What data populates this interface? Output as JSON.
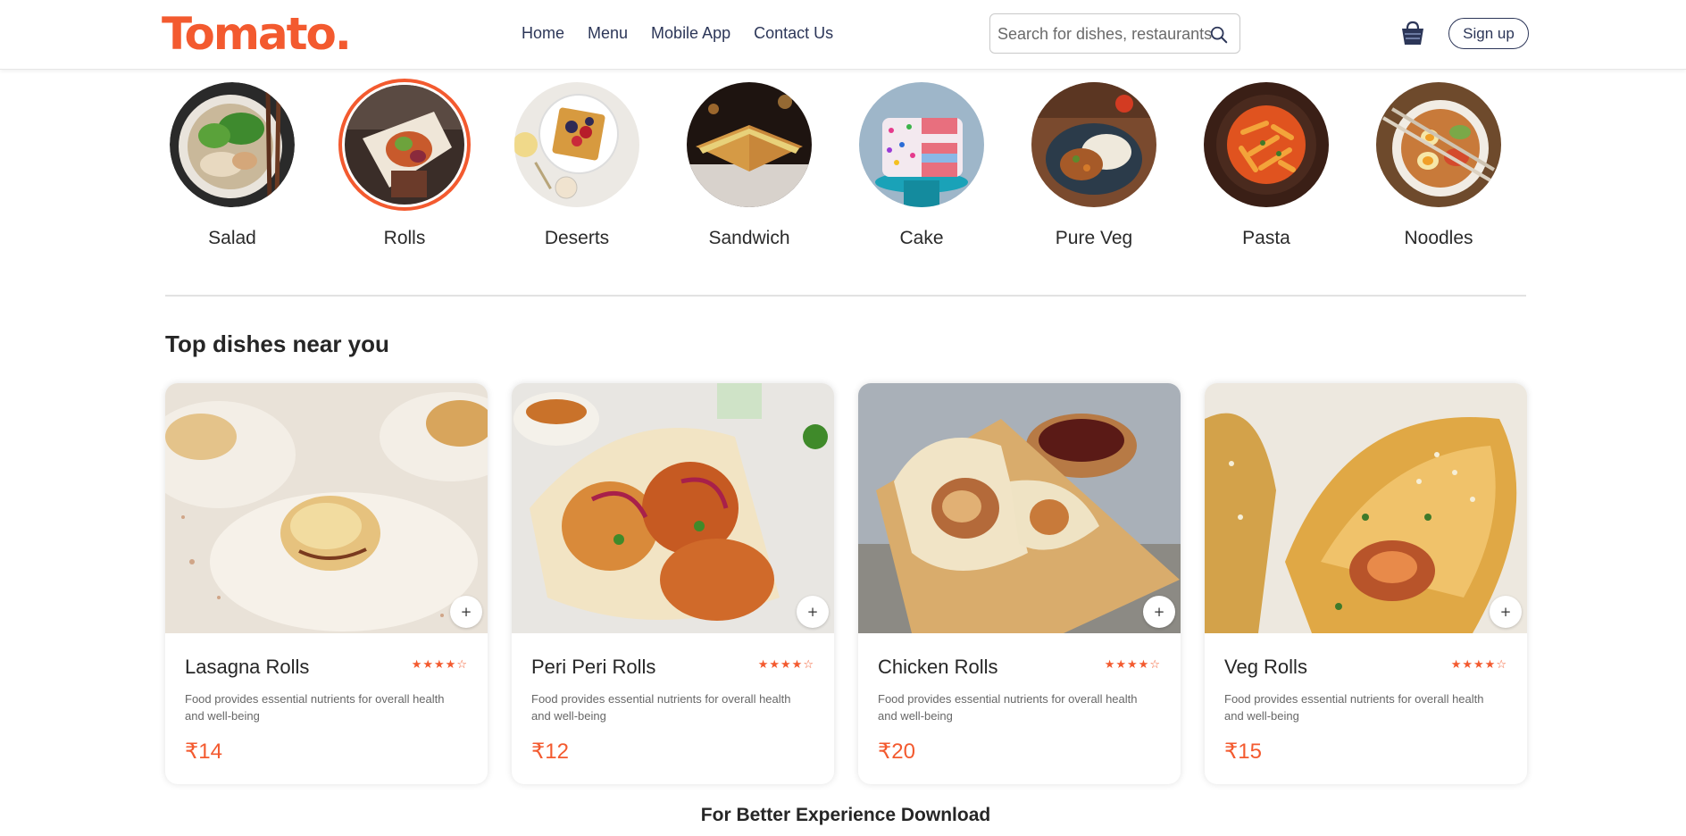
{
  "header": {
    "logo": "Tomato.",
    "nav": [
      "Home",
      "Menu",
      "Mobile App",
      "Contact Us"
    ],
    "search_placeholder": "Search for dishes, restaurants...",
    "signup_label": "Sign up",
    "accent_color": "#f35a2f"
  },
  "categories": [
    {
      "label": "Salad",
      "icon": "salad-image",
      "active": false
    },
    {
      "label": "Rolls",
      "icon": "rolls-image",
      "active": true
    },
    {
      "label": "Deserts",
      "icon": "deserts-image",
      "active": false
    },
    {
      "label": "Sandwich",
      "icon": "sandwich-image",
      "active": false
    },
    {
      "label": "Cake",
      "icon": "cake-image",
      "active": false
    },
    {
      "label": "Pure Veg",
      "icon": "pure-veg-image",
      "active": false
    },
    {
      "label": "Pasta",
      "icon": "pasta-image",
      "active": false
    },
    {
      "label": "Noodles",
      "icon": "noodles-image",
      "active": false
    }
  ],
  "dishes_section": {
    "title": "Top dishes near you",
    "items": [
      {
        "name": "Lasagna Rolls",
        "rating": 4,
        "description": "Food provides essential nutrients for overall health and well-being",
        "price": "₹14"
      },
      {
        "name": "Peri Peri Rolls",
        "rating": 4,
        "description": "Food provides essential nutrients for overall health and well-being",
        "price": "₹12"
      },
      {
        "name": "Chicken Rolls",
        "rating": 4,
        "description": "Food provides essential nutrients for overall health and well-being",
        "price": "₹20"
      },
      {
        "name": "Veg Rolls",
        "rating": 4,
        "description": "Food provides essential nutrients for overall health and well-being",
        "price": "₹15"
      }
    ],
    "add_symbol": "+"
  },
  "footer": {
    "download_text": "For Better Experience Download"
  }
}
